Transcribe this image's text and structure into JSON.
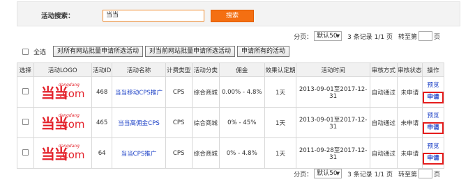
{
  "search": {
    "label": "活动搜索：",
    "value": "当当",
    "button": "搜索"
  },
  "pager": {
    "page_label": "分页：",
    "page_size": "默认50",
    "records": "3 条记录 1/1 页",
    "jump_label": "转至第",
    "page_suffix": "页"
  },
  "bulk": {
    "select_all": "全选",
    "buttons": [
      "对所有网站批量申请所选活动",
      "对当前网站批量申请所选活动",
      "申请所有的活动"
    ]
  },
  "table": {
    "headers": [
      "选择",
      "活动LOGO",
      "活动ID",
      "活动名称",
      "计费类型",
      "活动分类",
      "佣金",
      "效果认定期",
      "活动时间",
      "审核方式",
      "审核状态",
      "操作"
    ],
    "rows": [
      {
        "logo": {
          "big": "当当",
          "small": "dangdang",
          "com": ".com"
        },
        "id": "468",
        "name": "当当移动CPS推广",
        "billing": "CPS",
        "category": "综合商城",
        "commission": "0.00% - 4.8%",
        "period": "1天",
        "time": "2013-09-01至2017-12-31",
        "review": "自动通过",
        "status": "未申请",
        "preview": "预览",
        "apply": "申请"
      },
      {
        "logo": {
          "big": "当当",
          "small": "dangdang",
          "com": ".com"
        },
        "id": "465",
        "name": "当当高佣金CPS",
        "billing": "CPS",
        "category": "综合商城",
        "commission": "0% - 45%",
        "period": "1天",
        "time": "2013-09-01至2017-12-31",
        "review": "自动通过",
        "status": "未申请",
        "preview": "预览",
        "apply": "申请"
      },
      {
        "logo": {
          "big": "当当",
          "small": "dangdang",
          "com": ".com"
        },
        "id": "64",
        "name": "当当CPS推广",
        "billing": "CPS",
        "category": "综合商城",
        "commission": "0% - 4.8%",
        "period": "1天",
        "time": "2011-09-28至2017-12-31",
        "review": "自动通过",
        "status": "未申请",
        "preview": "预览",
        "apply": "申请"
      }
    ]
  },
  "colors": {
    "accent": "#f46f12",
    "link": "#1a3fc6",
    "highlight": "#e51c1c",
    "logo": "#e4222b"
  }
}
